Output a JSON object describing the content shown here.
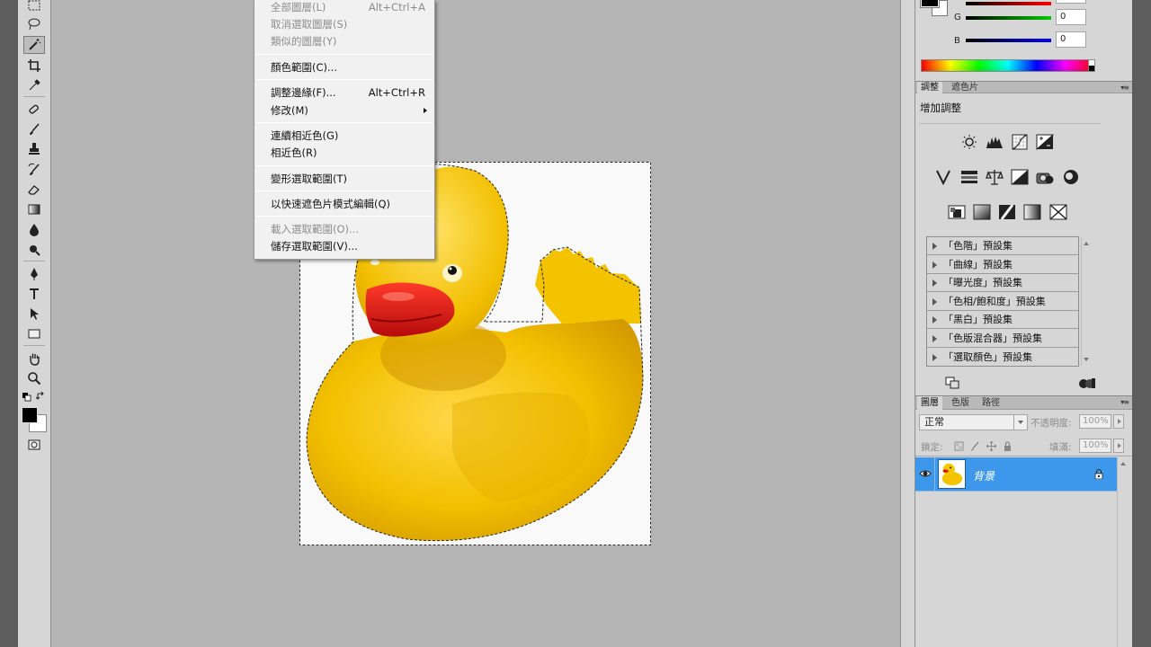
{
  "menu": {
    "items": [
      {
        "label": "全部圖層(L)",
        "shortcut": "Alt+Ctrl+A",
        "disabled": true
      },
      {
        "label": "取消選取圖層(S)",
        "shortcut": "",
        "disabled": true
      },
      {
        "label": "類似的圖層(Y)",
        "shortcut": "",
        "disabled": true
      },
      {
        "label": "顏色範圍(C)...",
        "shortcut": "",
        "disabled": false
      },
      {
        "label": "調整邊緣(F)...",
        "shortcut": "Alt+Ctrl+R",
        "disabled": false
      },
      {
        "label": "修改(M)",
        "shortcut": "",
        "disabled": false
      },
      {
        "label": "連續相近色(G)",
        "shortcut": "",
        "disabled": false
      },
      {
        "label": "相近色(R)",
        "shortcut": "",
        "disabled": false
      },
      {
        "label": "變形選取範圍(T)",
        "shortcut": "",
        "disabled": false
      },
      {
        "label": "以快速遮色片模式編輯(Q)",
        "shortcut": "",
        "disabled": false
      },
      {
        "label": "載入選取範圍(O)...",
        "shortcut": "",
        "disabled": true
      },
      {
        "label": "儲存選取範圍(V)...",
        "shortcut": "",
        "disabled": false
      }
    ]
  },
  "color_panel": {
    "g_label": "G",
    "g_value": "0",
    "b_label": "B",
    "b_value": "0"
  },
  "adjust_panel": {
    "tabs": [
      "調整",
      "遮色片"
    ],
    "title": "增加調整",
    "presets": [
      "「色階」預設集",
      "「曲線」預設集",
      "「曝光度」預設集",
      "「色相/飽和度」預設集",
      "「黑白」預設集",
      "「色版混合器」預設集",
      "「選取顏色」預設集"
    ]
  },
  "layers_panel": {
    "tabs": [
      "圖層",
      "色版",
      "路徑"
    ],
    "blend_mode": "正常",
    "opacity_label": "不透明度:",
    "opacity_value": "100%",
    "lock_label": "鎖定:",
    "fill_label": "填滿:",
    "fill_value": "100%",
    "layer_name": "背景"
  },
  "colors": {
    "accent_selected_layer": "#3d97ea",
    "duck_yellow": "#f5c400",
    "beak_red": "#d41212"
  }
}
